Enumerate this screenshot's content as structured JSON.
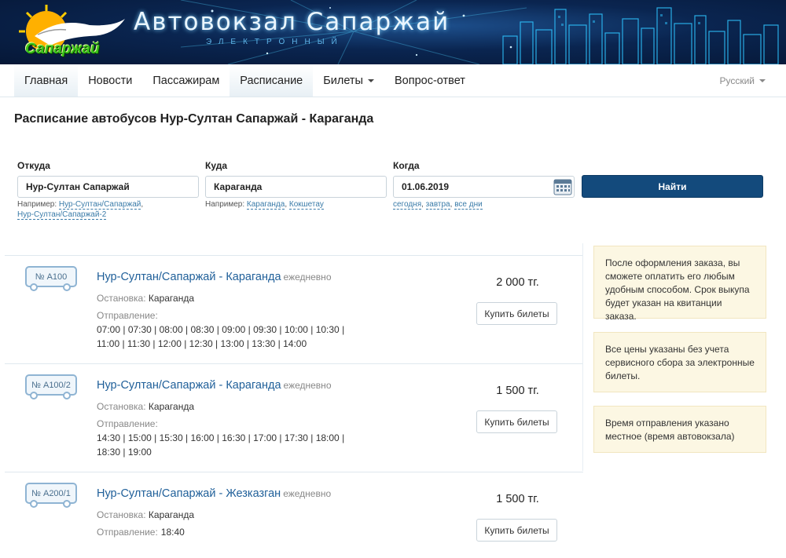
{
  "header": {
    "site_title": "Автовокзал Сапаржай",
    "site_subtitle": "ЭЛЕКТРОННЫЙ",
    "logo_text": "Сапаржай"
  },
  "nav": {
    "items": [
      {
        "label": "Главная",
        "active": true
      },
      {
        "label": "Новости",
        "active": false
      },
      {
        "label": "Пассажирам",
        "active": false
      },
      {
        "label": "Расписание",
        "active": true
      },
      {
        "label": "Билеты",
        "active": false,
        "dropdown": true
      },
      {
        "label": "Вопрос-ответ",
        "active": false
      }
    ],
    "language": "Русский"
  },
  "page": {
    "title": "Расписание автобусов Нур-Султан Сапаржай - Караганда"
  },
  "search": {
    "from": {
      "label": "Откуда",
      "value": "Нур-Султан Сапаржай",
      "hint_prefix": "Например:",
      "examples": [
        "Нур-Султан/Сапаржай",
        "Нур-Султан/Сапаржай-2"
      ]
    },
    "to": {
      "label": "Куда",
      "value": "Караганда",
      "hint_prefix": "Например:",
      "examples": [
        "Караганда",
        "Кокшетау"
      ]
    },
    "when": {
      "label": "Когда",
      "value": "01.06.2019",
      "quick": [
        "сегодня",
        "завтра",
        "все дни"
      ]
    },
    "submit_label": "Найти"
  },
  "results": [
    {
      "number": "№ А100",
      "route": "Нур-Султан/Сапаржай - Караганда",
      "frequency": "ежедневно",
      "stop_label": "Остановка:",
      "stop": "Караганда",
      "departure_label": "Отправление:",
      "times": "07:00 | 07:30 | 08:00 | 08:30 | 09:00 | 09:30 | 10:00 | 10:30 | 11:00 | 11:30 | 12:00 | 12:30 | 13:00 | 13:30 | 14:00",
      "price": "2 000 тг.",
      "buy_label": "Купить билеты"
    },
    {
      "number": "№ А100/2",
      "route": "Нур-Султан/Сапаржай - Караганда",
      "frequency": "ежедневно",
      "stop_label": "Остановка:",
      "stop": "Караганда",
      "departure_label": "Отправление:",
      "times": "14:30 | 15:00 | 15:30 | 16:00 | 16:30 | 17:00 | 17:30 | 18:00 | 18:30 | 19:00",
      "price": "1 500 тг.",
      "buy_label": "Купить билеты"
    },
    {
      "number": "№ А200/1",
      "route": "Нур-Султан/Сапаржай - Жезказган",
      "frequency": "ежедневно",
      "stop_label": "Остановка:",
      "stop": "Караганда",
      "departure_label": "Отправление:",
      "times": "18:40",
      "price": "1 500 тг.",
      "buy_label": "Купить билеты"
    }
  ],
  "notes": [
    "После оформления заказа, вы сможете оплатить его любым удобным способом. Срок выкупа будет указан на квитанции заказа.",
    "Все цены указаны без учета сервисного сбора за электронные билеты.",
    "Время отправления указано местное (время автовокзала)"
  ],
  "colors": {
    "brand_blue": "#134a7c",
    "link": "#1f5f99",
    "note_bg": "#fcf7e3",
    "logo_green": "#39c41a"
  }
}
